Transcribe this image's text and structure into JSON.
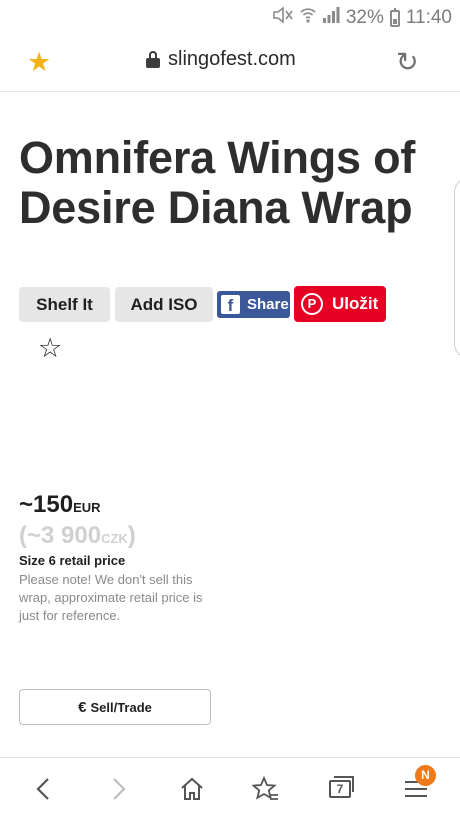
{
  "status_bar": {
    "battery_percent": "32%",
    "time": "11:40",
    "icons": [
      "mute-icon",
      "wifi-icon",
      "signal-icon",
      "battery-icon"
    ]
  },
  "url_bar": {
    "domain": "slingofest.com",
    "icons": [
      "bookmark-star-icon",
      "lock-icon",
      "reload-icon"
    ]
  },
  "product": {
    "title": "Omnifera Wings of Desire Diana Wrap"
  },
  "actions": {
    "shelf_label": "Shelf It",
    "iso_label": "Add ISO",
    "facebook_label": "Share",
    "pinterest_label": "Uložit",
    "facebook_logo": "f",
    "pinterest_logo": "P"
  },
  "price": {
    "main_value": "~150",
    "main_unit": "EUR",
    "alt_prefix": "(~3 900",
    "alt_unit": "CZK",
    "alt_suffix": ")",
    "size_label": "Size 6 retail price",
    "note": "Please note! We don't sell this wrap, approximate retail price is just for reference."
  },
  "sell": {
    "symbol": "€",
    "label": "Sell/Trade"
  },
  "bottom_nav": {
    "tabs_count": "7",
    "menu_badge": "N",
    "icons": [
      "back-icon",
      "forward-icon",
      "home-icon",
      "bookmarks-icon",
      "tabs-icon",
      "menu-icon"
    ]
  },
  "colors": {
    "bookmark_star": "#f6b21b",
    "facebook": "#3b5998",
    "pinterest": "#e60023",
    "badge": "#f07a1a"
  }
}
